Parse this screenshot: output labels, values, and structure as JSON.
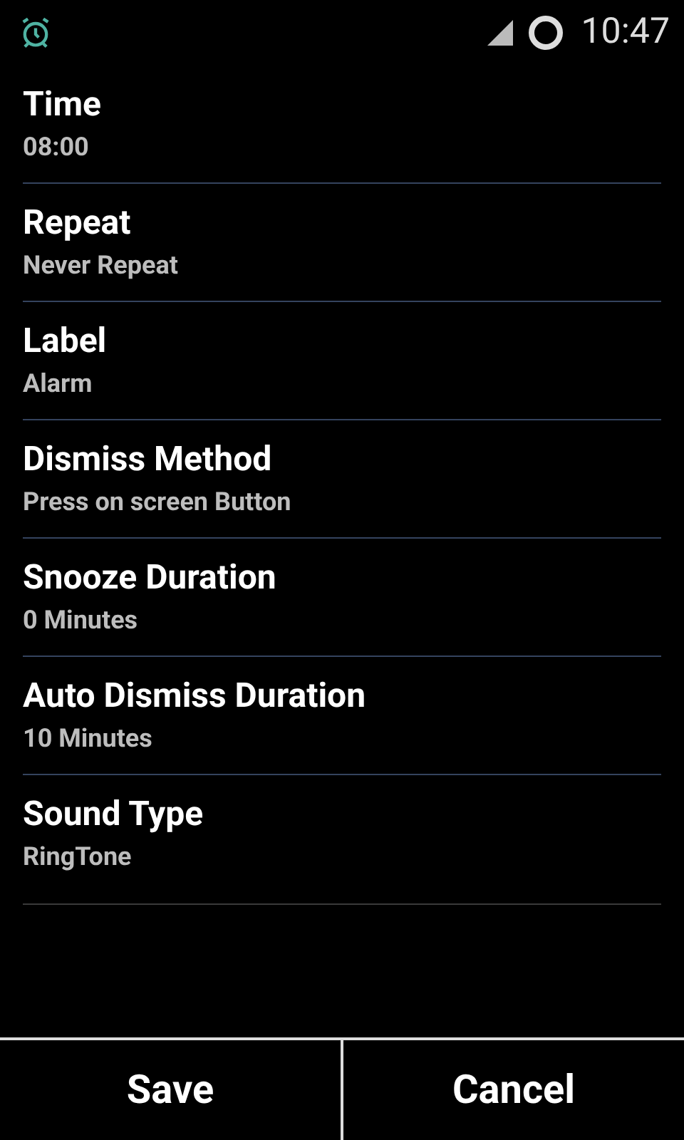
{
  "status_bar": {
    "time": "10:47"
  },
  "settings": [
    {
      "title": "Time",
      "value": "08:00"
    },
    {
      "title": "Repeat",
      "value": "Never Repeat"
    },
    {
      "title": "Label",
      "value": "Alarm"
    },
    {
      "title": "Dismiss Method",
      "value": "Press on screen Button"
    },
    {
      "title": "Snooze Duration",
      "value": "0 Minutes"
    },
    {
      "title": "Auto Dismiss Duration",
      "value": "10 Minutes"
    },
    {
      "title": "Sound Type",
      "value": "RingTone"
    }
  ],
  "buttons": [
    "Save",
    "Cancel"
  ]
}
